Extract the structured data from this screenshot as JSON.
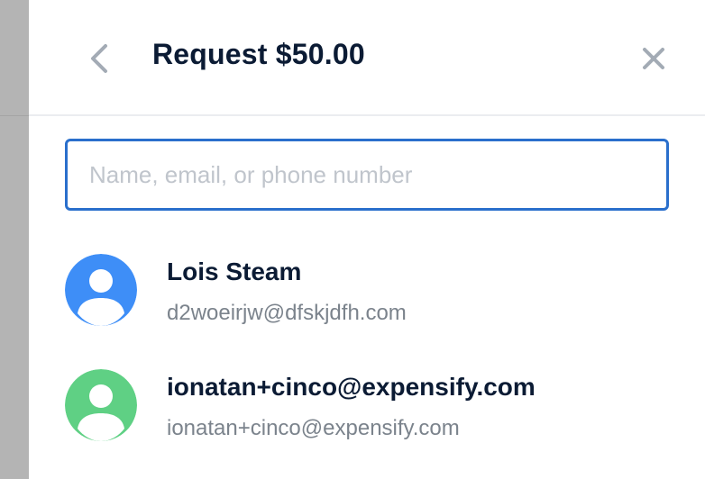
{
  "header": {
    "title": "Request $50.00",
    "back_icon": "chevron-left-icon",
    "close_icon": "close-icon"
  },
  "search": {
    "placeholder": "Name, email, or phone number",
    "value": ""
  },
  "contacts": [
    {
      "name": "Lois Steam",
      "email": "d2woeirjw@dfskjdfh.com",
      "avatar_color": "#3e8ef7",
      "icon": "user-avatar-icon"
    },
    {
      "name": "ionatan+cinco@expensify.com",
      "email": "ionatan+cinco@expensify.com",
      "avatar_color": "#5fd084",
      "icon": "user-avatar-icon"
    }
  ],
  "colors": {
    "accent": "#2a6fcc",
    "text_primary": "#0b1b34",
    "text_secondary": "#7b838c",
    "icon_gray": "#a3abb5"
  }
}
